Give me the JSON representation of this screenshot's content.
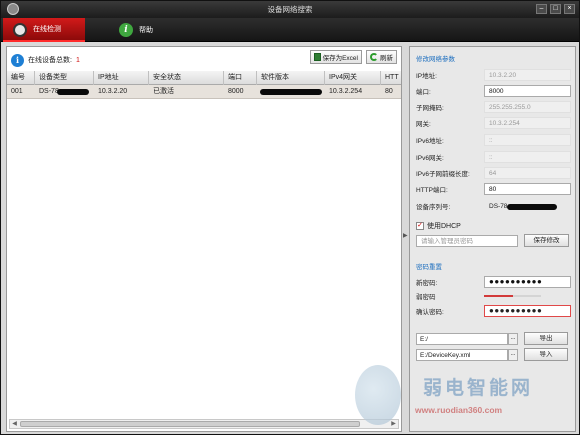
{
  "title": "设备网络搜索",
  "tabs": {
    "online": "在线检测",
    "help": "帮助"
  },
  "summary": {
    "label": "在线设备总数:",
    "count": "1"
  },
  "buttons": {
    "save_excel": "保存为Excel",
    "refresh": "刷新"
  },
  "table": {
    "headers": [
      "编号",
      "设备类型",
      "IP地址",
      "安全状态",
      "端口",
      "软件版本",
      "IPv4网关",
      "HTT"
    ],
    "rows": [
      {
        "no": "001",
        "type": "DS-78",
        "ip": "10.3.2.20",
        "security": "已激活",
        "port": "8000",
        "version": "",
        "gateway": "10.3.2.254",
        "http": "80"
      }
    ]
  },
  "modify": {
    "section": "修改网络参数",
    "ip_label": "IP地址:",
    "ip": "10.3.2.20",
    "port_label": "端口:",
    "port": "8000",
    "mask_label": "子网掩码:",
    "mask": "255.255.255.0",
    "gw_label": "网关:",
    "gw": "10.3.2.254",
    "ipv6_label": "IPv6地址:",
    "ipv6": "::",
    "ipv6gw_label": "IPv6网关:",
    "ipv6gw": "::",
    "ipv6len_label": "IPv6子网前缀长度:",
    "ipv6len": "64",
    "http_label": "HTTP端口:",
    "http": "80",
    "serial_label": "设备序列号:",
    "serial": "DS-78",
    "dhcp_label": "使用DHCP",
    "admin_pw_placeholder": "请输入管理员密码",
    "save_label": "保存修改"
  },
  "password": {
    "section": "密码重置",
    "new_label": "新密码:",
    "new_value": "●●●●●●●●●●",
    "strength_label": "弱密码",
    "strength": 0.5,
    "confirm_label": "确认密码:",
    "confirm_value": "●●●●●●●●●●"
  },
  "files": {
    "export_path": "E:/",
    "export_label": "导出",
    "import_path": "E:/DeviceKey.xml",
    "import_label": "导入",
    "browse": "..."
  },
  "watermark": {
    "text": "弱电智能网",
    "url": "www.ruodian360.com"
  },
  "colors": {
    "accent_red": "#c21414",
    "section_blue": "#1e6fbf",
    "row_highlight": "#e7e2dc"
  }
}
